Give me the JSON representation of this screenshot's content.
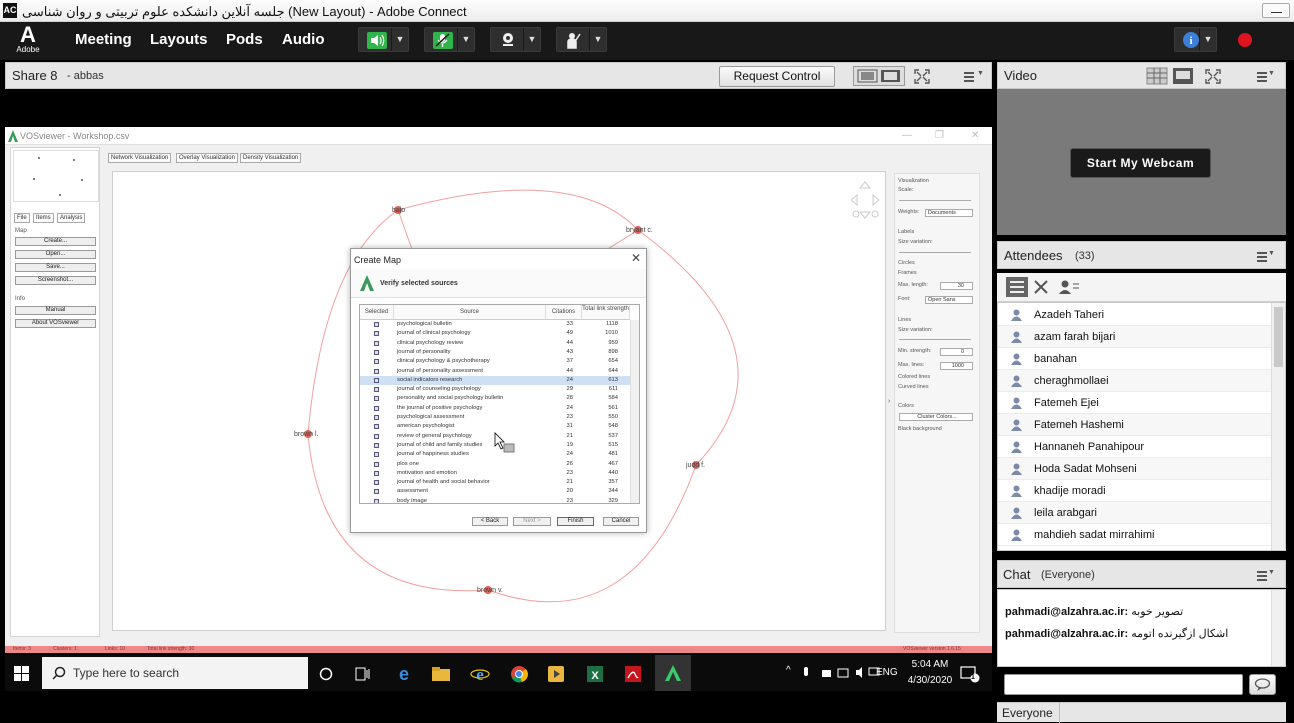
{
  "window": {
    "title": "جلسه آنلاین دانشکده علوم تربیتی و روان شناسی (New Layout) - Adobe Connect",
    "icon_text": "AC"
  },
  "menubar": {
    "logo_letter": "A",
    "logo_text": "Adobe",
    "items": [
      "Meeting",
      "Layouts",
      "Pods",
      "Audio"
    ],
    "icons": [
      "speaker-icon",
      "microphone-icon",
      "webcam-icon",
      "raise-hand-icon",
      "help-icon",
      "record-icon"
    ],
    "arrow": "▼"
  },
  "share": {
    "title": "Share 8",
    "presenter": "- abbas",
    "request_control": "Request Control",
    "menu_icon": "hamburger-icon"
  },
  "vosviewer": {
    "title": "VOSviewer - Workshop.csv",
    "tabs": [
      "Network Visualization",
      "Overlay Visualization",
      "Density Visualization"
    ],
    "left_tabs": [
      "File",
      "Items",
      "Analysis"
    ],
    "map_label": "Map",
    "buttons": [
      "Create...",
      "Open...",
      "Save...",
      "Screenshot..."
    ],
    "info_label": "Info",
    "info_buttons": [
      "Manual",
      "About VOSviewer"
    ],
    "nodes": [
      "bajo",
      "bryant c.",
      "brown l.",
      "judd f.",
      "brown v."
    ],
    "right_panel": {
      "visualization": "Visualization",
      "scale": "Scale:",
      "weights": "Weights:",
      "weights_value": "Documents",
      "labels": "Labels",
      "size_variation": "Size variation:",
      "circles": "Circles",
      "frames": "Frames",
      "max_length": "Max. length:",
      "max_length_value": "30",
      "font": "Font:",
      "font_value": "Open Sans",
      "lines": "Lines",
      "lines_size_variation": "Size variation:",
      "min_strength": "Min. strength:",
      "min_strength_value": "0",
      "max_lines": "Max. lines:",
      "max_lines_value": "1000",
      "colored_lines": "Colored lines",
      "curved_lines": "Curved lines",
      "colors": "Colors",
      "cluster_colors": "Cluster Colors...",
      "black_background": "Black background"
    },
    "status": {
      "items": "Items: 3",
      "clusters": "Clusters: 1",
      "links": "Links: 10",
      "total_link_strength": "Total link strength: 30",
      "version": "VOSviewer version 1.6.15"
    }
  },
  "dialog": {
    "title": "Create Map",
    "subtitle": "Verify selected sources",
    "close": "✕",
    "columns": [
      "Selected",
      "Source",
      "Citations",
      "Total link strength"
    ],
    "rows": [
      [
        "psychological bulletin",
        "33",
        "1118"
      ],
      [
        "journal of clinical psychology",
        "49",
        "1010"
      ],
      [
        "clinical psychology review",
        "44",
        "959"
      ],
      [
        "journal of personality",
        "43",
        "898"
      ],
      [
        "clinical psychology & psychotherapy",
        "37",
        "654"
      ],
      [
        "journal of personality assessment",
        "44",
        "644"
      ],
      [
        "social indicators research",
        "24",
        "613"
      ],
      [
        "journal of counseling psychology",
        "29",
        "611"
      ],
      [
        "personality and social psychology bulletin",
        "28",
        "584"
      ],
      [
        "the journal of positive psychology",
        "24",
        "561"
      ],
      [
        "psychological assessment",
        "23",
        "550"
      ],
      [
        "american psychologist",
        "31",
        "548"
      ],
      [
        "review of general psychology",
        "21",
        "537"
      ],
      [
        "journal of child and family studies",
        "19",
        "515"
      ],
      [
        "journal of happiness studies",
        "24",
        "481"
      ],
      [
        "plos one",
        "26",
        "467"
      ],
      [
        "motivation and emotion",
        "23",
        "440"
      ],
      [
        "journal of health and social behavior",
        "21",
        "357"
      ],
      [
        "assessment",
        "20",
        "344"
      ],
      [
        "body image",
        "23",
        "329"
      ]
    ],
    "buttons": {
      "back": "< Back",
      "next": "Next >",
      "finish": "Finish",
      "cancel": "Cancel"
    }
  },
  "taskbar": {
    "search_placeholder": "Type here to search",
    "lang": "ENG",
    "time": "5:04 AM",
    "date": "4/30/2020",
    "notification_count": "1"
  },
  "video": {
    "title": "Video",
    "webcam_button": "Start My Webcam"
  },
  "attendees": {
    "title": "Attendees",
    "count": "(33)",
    "list": [
      "Azadeh Taheri",
      "azam farah bijari",
      "banahan",
      "cheraghmollaei",
      "Fatemeh Ejei",
      "Fatemeh Hashemi",
      "Hannaneh Panahipour",
      "Hoda Sadat Mohseni",
      "khadije moradi",
      "leila arabgari",
      "mahdieh sadat mirrahimi"
    ]
  },
  "chat": {
    "title": "Chat",
    "scope": "(Everyone)",
    "messages": [
      {
        "sender": "pahmadi@alzahra.ac.ir:",
        "text": "تصویر خوبه"
      },
      {
        "sender": "pahmadi@alzahra.ac.ir:",
        "text": "اشکال ازگیرنده اتومه"
      }
    ],
    "footer": "Everyone"
  },
  "colors": {
    "accent_green": "#2fb54a",
    "record_red": "#e0141e",
    "help_blue": "#3b7fd8",
    "node_red": "#e0443a"
  }
}
